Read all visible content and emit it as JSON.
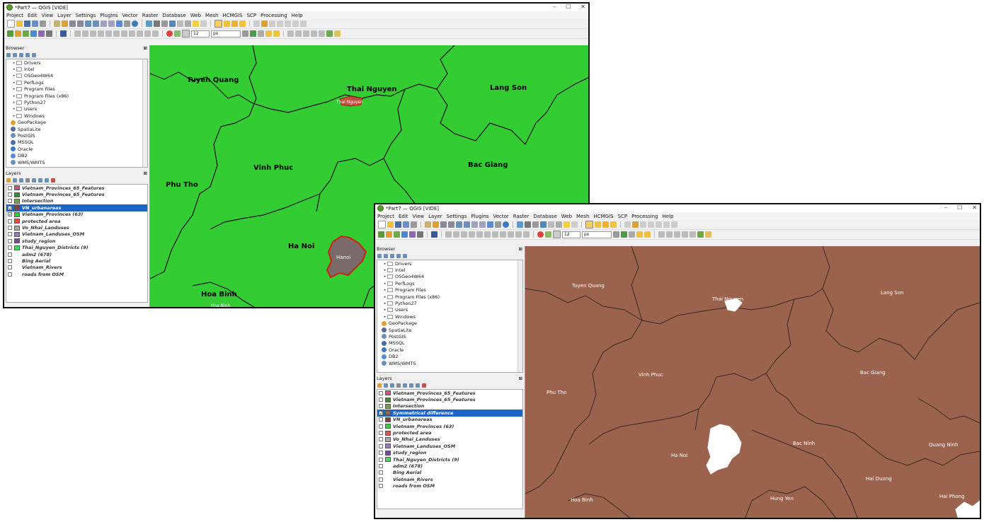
{
  "window1": {
    "title": "*Part7 — QGIS [VIDE]",
    "menu": [
      "Project",
      "Edit",
      "View",
      "Layer",
      "Settings",
      "Plugins",
      "Vector",
      "Raster",
      "Database",
      "Web",
      "Mesh",
      "HCMGIS",
      "SCP",
      "Processing",
      "Help"
    ],
    "size_value": "12",
    "unit_value": "px",
    "browser_title": "Browser",
    "layers_title": "Layers",
    "map_color": "#33cc33",
    "browser_items": [
      "Drivers",
      "Intel",
      "OSGeo4W64",
      "PerfLogs",
      "Program Files",
      "Program Files (x86)",
      "Python27",
      "Users",
      "Windows",
      "GeoPackage",
      "SpatiaLite",
      "PostGIS",
      "MSSQL",
      "Oracle",
      "DB2",
      "WMS/WMTS"
    ],
    "layers": [
      {
        "name": "Vietnam_Provinces_65_Features",
        "color": "#d05080",
        "checked": false
      },
      {
        "name": "Vietnam_Provinces_65_Features",
        "color": "#3c8a3c",
        "checked": false
      },
      {
        "name": "Intersection",
        "color": "#7a9a55",
        "checked": false
      },
      {
        "name": "VN_urbanareas",
        "color": "#8a3a3a",
        "checked": true,
        "selected": true
      },
      {
        "name": "Vietnam_Provinces (63)",
        "color": "#33cc33",
        "checked": true
      },
      {
        "name": "protected area",
        "color": "#e05050",
        "checked": false
      },
      {
        "name": "Vo_Nhai_Landuses",
        "color": "#aaaaaa",
        "checked": false
      },
      {
        "name": "Vietnam_Landuses_OSM",
        "color": "#9a7ab8",
        "checked": false
      },
      {
        "name": "study_region",
        "color": "#7a4a9a",
        "checked": false
      },
      {
        "name": "Thai_Nguyen_Districts (9)",
        "color": "#44dd55",
        "checked": false
      },
      {
        "name": "adm2 (678)",
        "color": "",
        "checked": false
      },
      {
        "name": "Bing Aerial",
        "color": "",
        "checked": false
      },
      {
        "name": "Vietnam_Rivers",
        "color": "",
        "checked": false
      },
      {
        "name": "roads from OSM",
        "color": "",
        "checked": false
      }
    ],
    "labels": {
      "tuyen_quang": "Tuyen Quang",
      "thai_nguyen": "Thai Nguyen",
      "thai_nguyen_small": "Thai Nguyen",
      "lang_son": "Lang Son",
      "vinh_phuc": "Vinh Phuc",
      "bac_giang": "Bac Giang",
      "phu_tho": "Phu Tho",
      "ha_noi": "Ha Noi",
      "hanoi_small": "Hanoi",
      "hoa_binh": "Hoa Binh",
      "hoa_binh_small": "Hoa Binh"
    }
  },
  "window2": {
    "title": "*Part7 — QGIS [VIDE]",
    "menu": [
      "Project",
      "Edit",
      "View",
      "Layer",
      "Settings",
      "Plugins",
      "Vector",
      "Raster",
      "Database",
      "Web",
      "Mesh",
      "HCMGIS",
      "SCP",
      "Processing",
      "Help"
    ],
    "size_value": "12",
    "unit_value": "px",
    "browser_title": "Browser",
    "layers_title": "Layers",
    "map_color": "#9b634d",
    "browser_items": [
      "Drivers",
      "Intel",
      "OSGeo4W64",
      "PerfLogs",
      "Program Files",
      "Program Files (x86)",
      "Python27",
      "Users",
      "Windows",
      "GeoPackage",
      "SpatiaLite",
      "PostGIS",
      "MSSQL",
      "Oracle",
      "DB2",
      "WMS/WMTS"
    ],
    "layers": [
      {
        "name": "Vietnam_Provinces_65_Features",
        "color": "#d05080",
        "checked": false
      },
      {
        "name": "Vietnam_Provinces_65_Features",
        "color": "#3c8a3c",
        "checked": false
      },
      {
        "name": "Intersection",
        "color": "#7a9a55",
        "checked": false
      },
      {
        "name": "Symmetrical difference",
        "color": "#9b634d",
        "checked": true,
        "selected": true
      },
      {
        "name": "VN_urbanareas",
        "color": "#8a3a3a",
        "checked": false
      },
      {
        "name": "Vietnam_Provinces (63)",
        "color": "#44cc44",
        "checked": false
      },
      {
        "name": "protected area",
        "color": "#e05050",
        "checked": false
      },
      {
        "name": "Vo_Nhai_Landuses",
        "color": "#aaaaaa",
        "checked": false
      },
      {
        "name": "Vietnam_Landuses_OSM",
        "color": "#9a7ab8",
        "checked": false
      },
      {
        "name": "study_region",
        "color": "#7a4a9a",
        "checked": false
      },
      {
        "name": "Thai_Nguyen_Districts (9)",
        "color": "#44dd55",
        "checked": false
      },
      {
        "name": "adm2 (678)",
        "color": "",
        "checked": false
      },
      {
        "name": "Bing Aerial",
        "color": "",
        "checked": false
      },
      {
        "name": "Vietnam_Rivers",
        "color": "",
        "checked": false
      },
      {
        "name": "roads from OSM",
        "color": "",
        "checked": false
      }
    ],
    "labels": {
      "tuyen_quang": "Tuyen Quang",
      "thai_nguyen": "Thai Nguyen",
      "lang_son": "Lang Son",
      "vinh_phuc": "Vinh Phuc",
      "bac_giang": "Bac Giang",
      "phu_tho": "Phu Tho",
      "ha_noi": "Ha Noi",
      "bac_ninh": "Bac Ninh",
      "quang_ninh": "Quang Ninh",
      "hai_duong": "Hai Duong",
      "hoa_binh": "Hoa Binh",
      "hung_yen": "Hung Yen",
      "hai_phong": "Hai Phong"
    }
  }
}
